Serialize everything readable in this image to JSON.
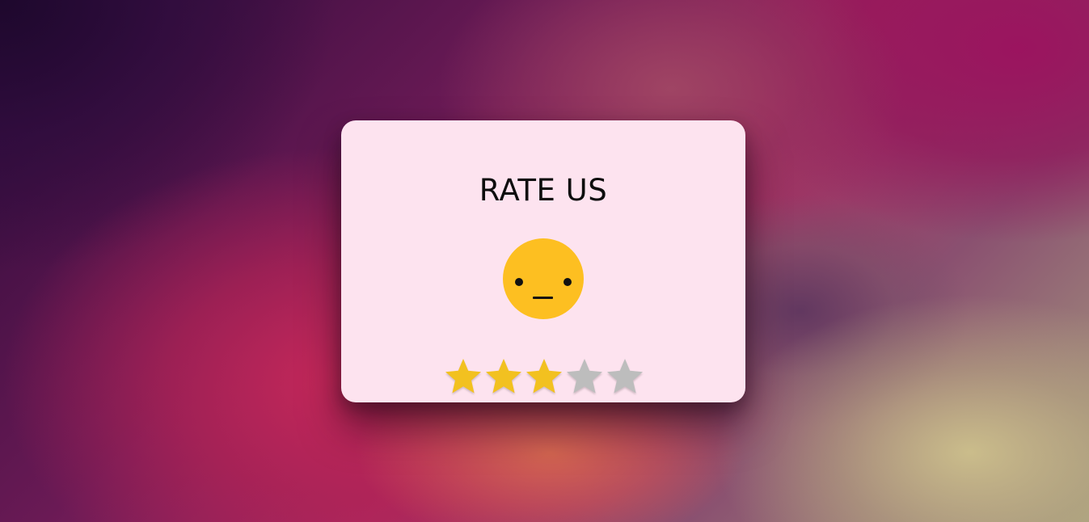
{
  "card": {
    "title": "RATE US"
  },
  "emoji": {
    "icon": "neutral-face-icon",
    "color": "#fdbf21"
  },
  "rating": {
    "value": 3,
    "max": 5,
    "filled_color": "#f2c120",
    "empty_color": "#bdbdbd",
    "icon": "star-icon"
  }
}
